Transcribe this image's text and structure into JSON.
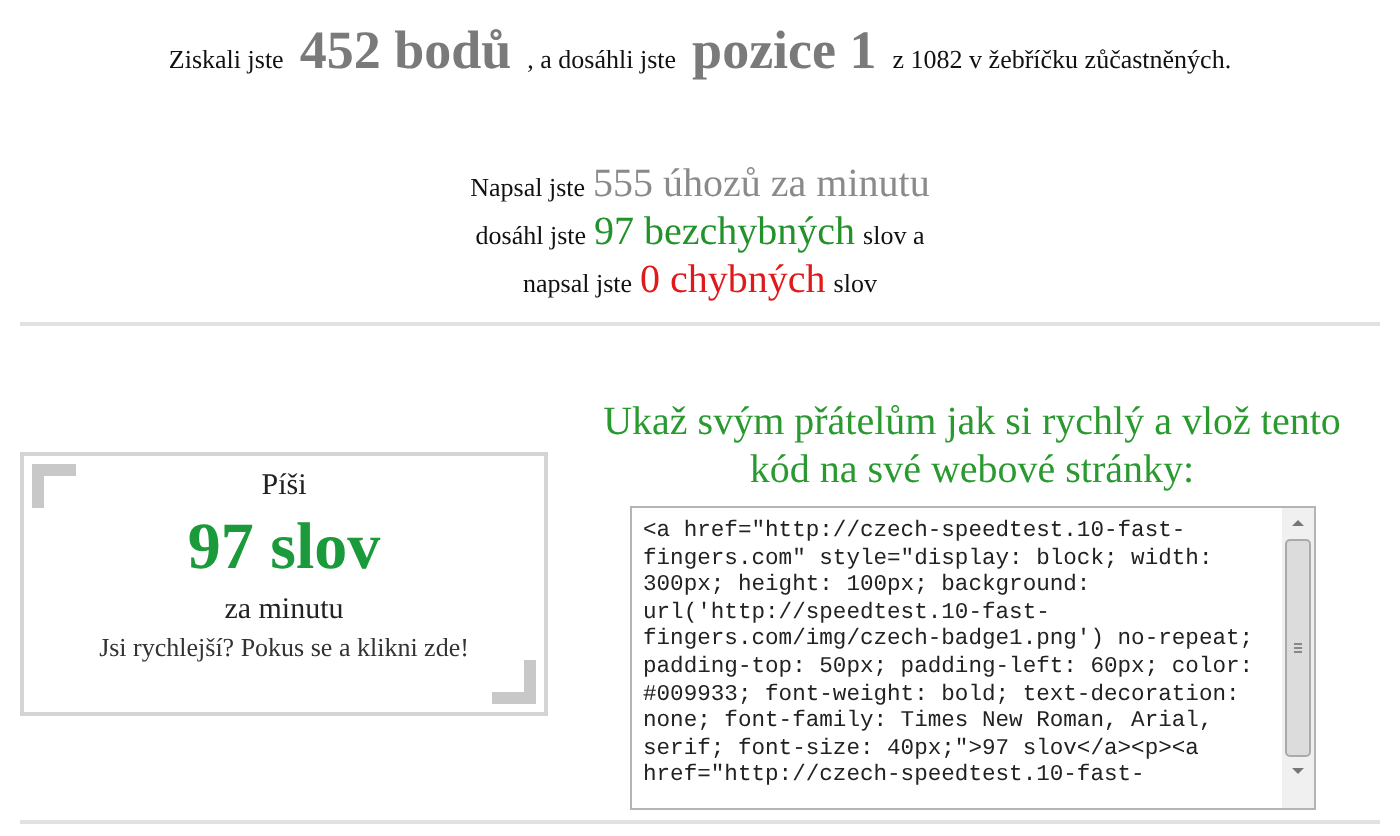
{
  "summary": {
    "prefix": "Ziskali jste",
    "points": "452 bodů",
    "middle": ", a dosáhli jste",
    "rank": "pozice 1",
    "suffix": "z 1082 v žebříčku zůčastněných."
  },
  "stats": [
    {
      "before": "Napsal jste",
      "value": "555 úhozů za minutu",
      "kind": "neutral"
    },
    {
      "before": "dosáhl jste",
      "value": "97 bezchybných",
      "after": "slov a",
      "kind": "correct"
    },
    {
      "before": "napsal jste",
      "value": "0 chybných",
      "after": "slov",
      "kind": "wrong"
    }
  ],
  "badge": {
    "title": "Píši",
    "score": "97 slov",
    "unit": "za minutu",
    "link": "Jsi rychlejší? Pokus se a klikni zde!"
  },
  "share": {
    "heading": "Ukaž svým přátelům jak si rychlý a vlož tento kód na své webové stránky:",
    "code_lines": [
      "<a href=\"http://czech-speedtest.10-fast-",
      "fingers.com\" style=\"display: block; width:",
      "300px; height: 100px; background:",
      "url('http://speedtest.10-fast-",
      "fingers.com/img/czech-badge1.png') no-repeat;",
      "padding-top: 50px; padding-left: 60px; color:",
      "#009933; font-weight: bold; text-decoration:",
      "none; font-family: Times New Roman, Arial,",
      "serif; font-size: 40px;\">97 slov</a><p><a",
      "href=\"http://czech-speedtest.10-fast-"
    ]
  }
}
